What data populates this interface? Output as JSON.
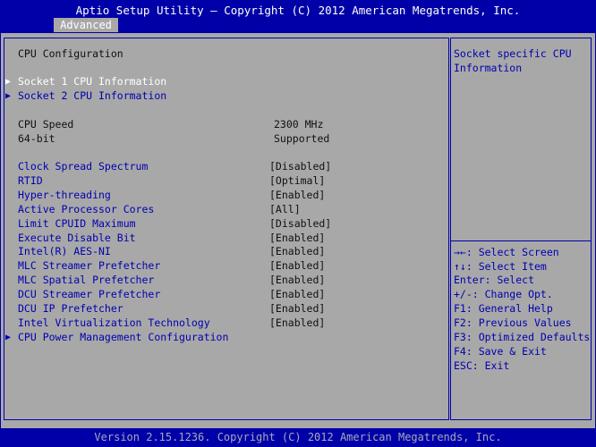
{
  "header": {
    "title": "Aptio Setup Utility – Copyright (C) 2012 American Megatrends, Inc.",
    "tab": "Advanced"
  },
  "section_title": "CPU Configuration",
  "submenus_top": [
    {
      "label": "Socket 1 CPU Information",
      "selected": true
    },
    {
      "label": "Socket 2 CPU Information",
      "selected": false
    }
  ],
  "info": [
    {
      "label": "CPU Speed",
      "value": "2300 MHz"
    },
    {
      "label": "64-bit",
      "value": "Supported"
    }
  ],
  "options": [
    {
      "label": "Clock Spread Spectrum",
      "value": "[Disabled]"
    },
    {
      "label": "RTID",
      "value": "[Optimal]"
    },
    {
      "label": "Hyper-threading",
      "value": "[Enabled]"
    },
    {
      "label": "Active Processor Cores",
      "value": "[All]"
    },
    {
      "label": "Limit CPUID Maximum",
      "value": "[Disabled]"
    },
    {
      "label": "Execute Disable Bit",
      "value": "[Enabled]"
    },
    {
      "label": "Intel(R) AES-NI",
      "value": "[Enabled]"
    },
    {
      "label": "MLC Streamer Prefetcher",
      "value": "[Enabled]"
    },
    {
      "label": "MLC Spatial Prefetcher",
      "value": "[Enabled]"
    },
    {
      "label": "DCU Streamer Prefetcher",
      "value": "[Enabled]"
    },
    {
      "label": "DCU IP Prefetcher",
      "value": "[Enabled]"
    },
    {
      "label": "Intel Virtualization Technology",
      "value": "[Enabled]"
    }
  ],
  "submenu_bottom": {
    "label": "CPU Power Management Configuration"
  },
  "help": {
    "line1": "Socket specific CPU",
    "line2": "Information"
  },
  "keys": [
    "→←: Select Screen",
    "↑↓: Select Item",
    "Enter: Select",
    "+/-: Change Opt.",
    "F1: General Help",
    "F2: Previous Values",
    "F3: Optimized Defaults",
    "F4: Save & Exit",
    "ESC: Exit"
  ],
  "footer": "Version 2.15.1236. Copyright (C) 2012 American Megatrends, Inc.",
  "colors": {
    "accent": "#0000a8",
    "background": "#a8a8a8",
    "highlight": "#ffffff"
  }
}
